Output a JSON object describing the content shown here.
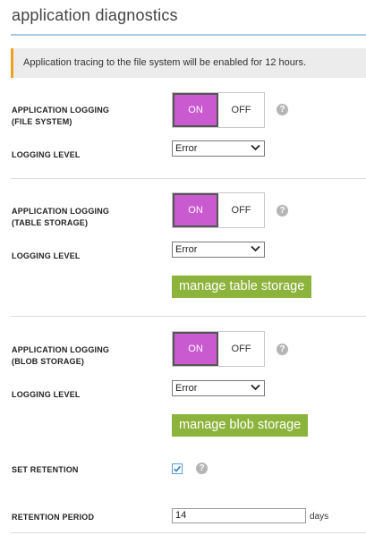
{
  "page": {
    "title": "application diagnostics"
  },
  "banner": {
    "text": "Application tracing to the file system will be enabled for 12 hours.",
    "accent_color": "#f0a020"
  },
  "sections": [
    {
      "label_line1": "APPLICATION LOGGING",
      "label_line2": "(FILE SYSTEM)",
      "toggle_on": "ON",
      "toggle_off": "OFF",
      "state": "on",
      "level_label": "LOGGING LEVEL",
      "level_value": "Error"
    },
    {
      "label_line1": "APPLICATION LOGGING",
      "label_line2": "(TABLE STORAGE)",
      "toggle_on": "ON",
      "toggle_off": "OFF",
      "state": "on",
      "level_label": "LOGGING LEVEL",
      "level_value": "Error",
      "button_label": "manage table storage"
    },
    {
      "label_line1": "APPLICATION LOGGING",
      "label_line2": "(BLOB STORAGE)",
      "toggle_on": "ON",
      "toggle_off": "OFF",
      "state": "on",
      "level_label": "LOGGING LEVEL",
      "level_value": "Error",
      "button_label": "manage blob storage"
    }
  ],
  "retention": {
    "set_label": "SET RETENTION",
    "checked": true,
    "period_label": "RETENTION PERIOD",
    "period_value": "14",
    "period_unit": "days"
  },
  "icons": {
    "help": "question-mark-icon",
    "dropdown": "chevron-down-icon",
    "check": "checkmark-icon"
  },
  "colors": {
    "toggle_on": "#c95ad0",
    "button_green": "#8cb33c",
    "title_rule": "#a9cbe6"
  }
}
